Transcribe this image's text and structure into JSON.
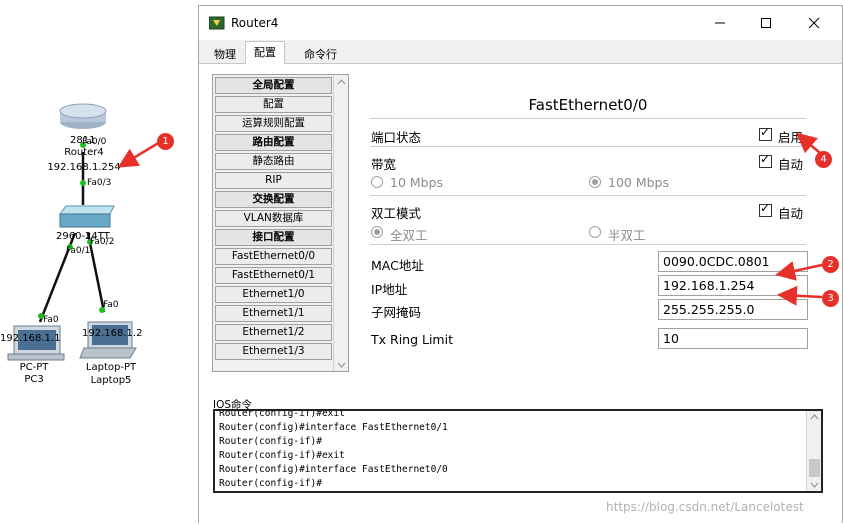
{
  "window": {
    "title": "Router4",
    "tabs": [
      "物理",
      "配置",
      "命令行"
    ],
    "active_tab": "配置"
  },
  "nav": {
    "items": [
      {
        "label": "全局配置",
        "header": true
      },
      {
        "label": "配置",
        "header": false
      },
      {
        "label": "运算规则配置",
        "header": false
      },
      {
        "label": "路由配置",
        "header": true
      },
      {
        "label": "静态路由",
        "header": false
      },
      {
        "label": "RIP",
        "header": false
      },
      {
        "label": "交换配置",
        "header": true
      },
      {
        "label": "VLAN数据库",
        "header": false
      },
      {
        "label": "接口配置",
        "header": true
      },
      {
        "label": "FastEthernet0/0",
        "header": false
      },
      {
        "label": "FastEthernet0/1",
        "header": false
      },
      {
        "label": "Ethernet1/0",
        "header": false
      },
      {
        "label": "Ethernet1/1",
        "header": false
      },
      {
        "label": "Ethernet1/2",
        "header": false
      },
      {
        "label": "Ethernet1/3",
        "header": false
      }
    ]
  },
  "config": {
    "title": "FastEthernet0/0",
    "port_status_label": "端口状态",
    "port_on_label": "启用",
    "bandwidth_label": "带宽",
    "bandwidth_auto_label": "自动",
    "bw_10": "10 Mbps",
    "bw_100": "100 Mbps",
    "duplex_label": "双工模式",
    "duplex_auto_label": "自动",
    "full_duplex": "全双工",
    "half_duplex": "半双工",
    "mac_label": "MAC地址",
    "mac_value": "0090.0CDC.0801",
    "ip_label": "IP地址",
    "ip_value": "192.168.1.254",
    "mask_label": "子网掩码",
    "mask_value": "255.255.255.0",
    "txring_label": "Tx Ring Limit",
    "txring_value": "10"
  },
  "ios": {
    "label": "IOS命令",
    "lines": [
      "Router(config-if)#exit",
      "Router(config)#interface FastEthernet0/1",
      "Router(config-if)#",
      "Router(config-if)#exit",
      "Router(config)#interface FastEthernet0/0",
      "Router(config-if)#"
    ]
  },
  "topology": {
    "router_model": "2811",
    "router_name": "Router4",
    "router_ip": "192.168.1.254",
    "router_if_top": "Fa0/0",
    "router_if_bottom": "Fa0/3",
    "switch_model": "2960-24TT",
    "switch_if_right": "Fa0/2",
    "switch_if_left": "Fa0/1",
    "pc_if": "Fa0",
    "pc_ip": "192.168.1.1",
    "pc_type": "PC-PT",
    "pc_name": "PC3",
    "laptop_if": "Fa0",
    "laptop_ip": "192.168.1.2",
    "laptop_type": "Laptop-PT",
    "laptop_name": "Laptop5"
  },
  "annotations": [
    "1",
    "2",
    "3",
    "4"
  ],
  "watermark": "https://blog.csdn.net/Lancelotest",
  "colors": {
    "annotation_red": "#e8302a",
    "link_green": "#1fbf1f"
  }
}
